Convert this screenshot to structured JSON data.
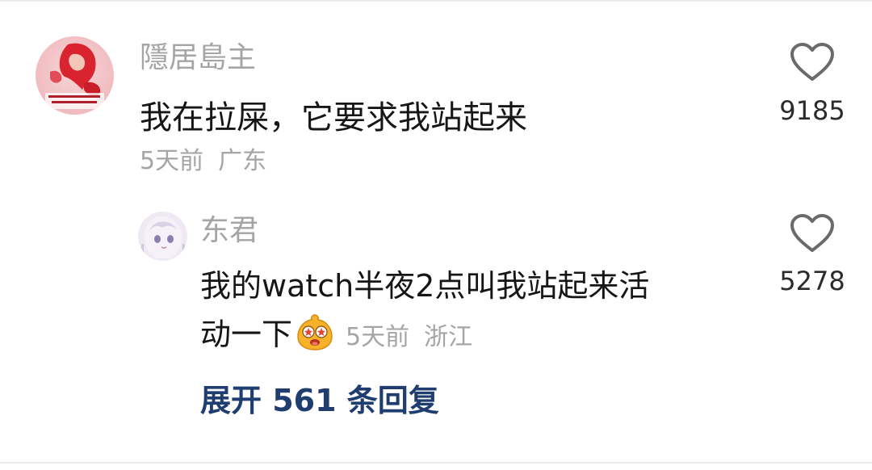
{
  "comment": {
    "username": "隱居島主",
    "text": "我在拉屎，它要求我站起来",
    "time": "5天前",
    "location": "广东",
    "likes": "9185",
    "avatar_icon": "illustrated-avatar-icon"
  },
  "reply": {
    "username": "东君",
    "text_line1": "我的watch半夜2点叫我站起来活",
    "text_line2": "动一下",
    "emoji_icon": "star-eyes-emoji-icon",
    "time": "5天前",
    "location": "浙江",
    "likes": "5278",
    "avatar_icon": "anime-avatar-icon"
  },
  "expand_label": "展开 561 条回复",
  "colors": {
    "username": "#a5a5a5",
    "text": "#161616",
    "link": "#1f3d6e",
    "icon": "#6a6a6a"
  }
}
